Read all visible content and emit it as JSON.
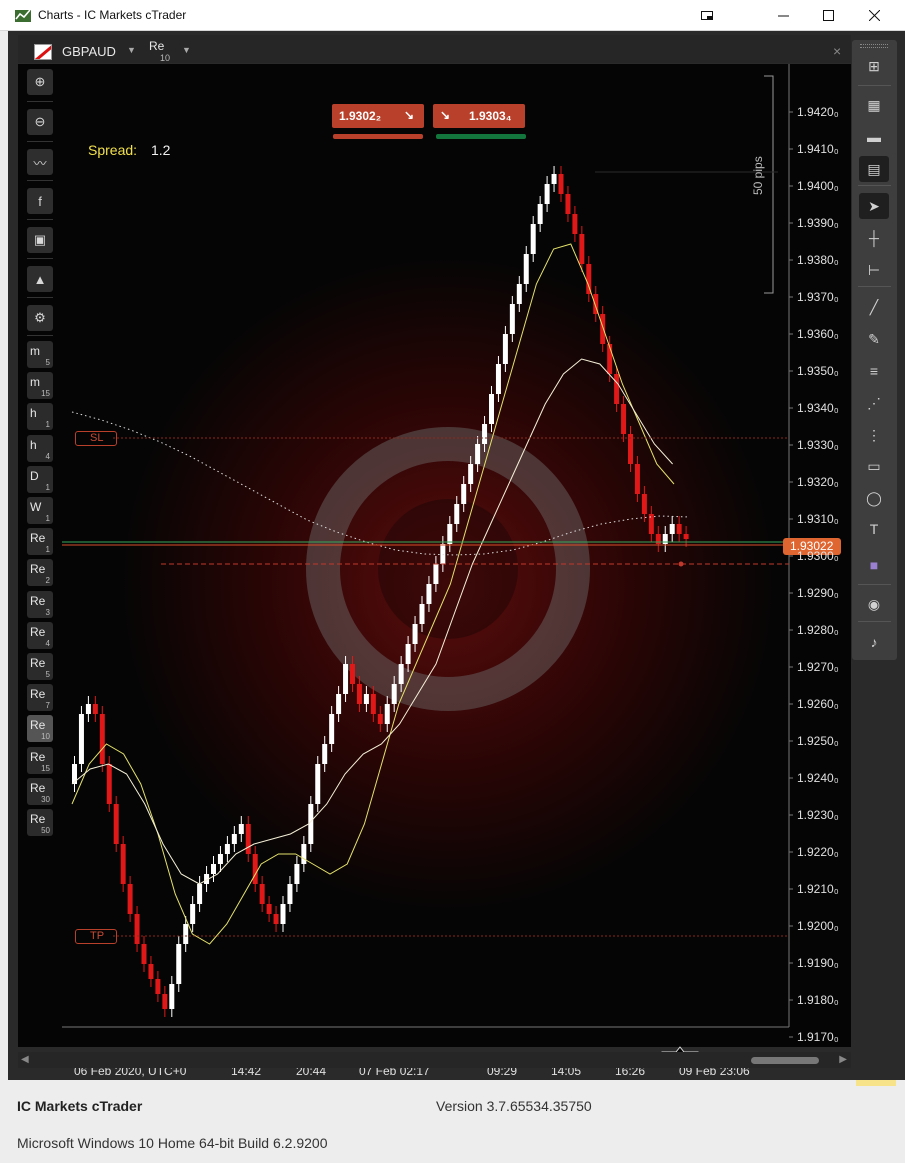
{
  "window": {
    "title": "Charts - IC Markets cTrader",
    "cast_icon": "cast-icon",
    "min_icon": "minimize-icon",
    "max_icon": "maximize-icon",
    "close_icon": "close-icon"
  },
  "chart_header": {
    "symbol": "GBPAUD",
    "timeframe": "Re",
    "timeframe_sub": "10",
    "close_symbol": "×"
  },
  "left_toolbar": {
    "tools": [
      {
        "name": "zoom-in-icon",
        "glyph": "⊕"
      },
      {
        "name": "zoom-out-icon",
        "glyph": "⊖"
      },
      {
        "name": "indicators-icon",
        "glyph": "〰"
      },
      {
        "name": "facebook-icon",
        "glyph": "f"
      },
      {
        "name": "robot-icon",
        "glyph": "▣"
      },
      {
        "name": "patterns-icon",
        "glyph": "▲"
      },
      {
        "name": "settings-icon",
        "glyph": "⚙"
      }
    ],
    "timeframes": [
      {
        "main": "m",
        "sub": "5"
      },
      {
        "main": "m",
        "sub": "15"
      },
      {
        "main": "h",
        "sub": "1"
      },
      {
        "main": "h",
        "sub": "4"
      },
      {
        "main": "D",
        "sub": "1"
      },
      {
        "main": "W",
        "sub": "1"
      },
      {
        "main": "Re",
        "sub": "1"
      },
      {
        "main": "Re",
        "sub": "2"
      },
      {
        "main": "Re",
        "sub": "3"
      },
      {
        "main": "Re",
        "sub": "4"
      },
      {
        "main": "Re",
        "sub": "5"
      },
      {
        "main": "Re",
        "sub": "7"
      },
      {
        "main": "Re",
        "sub": "10"
      },
      {
        "main": "Re",
        "sub": "15"
      },
      {
        "main": "Re",
        "sub": "30"
      },
      {
        "main": "Re",
        "sub": "50"
      }
    ],
    "active_timeframe_index": 12
  },
  "spread": {
    "label": "Spread:",
    "value": "1.2"
  },
  "quick_trade": {
    "sell_price": "1.9302₂",
    "buy_price": "1.9303₄",
    "sell_color": "#b9402a",
    "buy_color": "#13763c"
  },
  "levels": {
    "sl_label": "SL",
    "tp_label": "TP"
  },
  "current_price": "1.93022",
  "pips_label": "50 pips",
  "price_axis": [
    "1.9420₀",
    "1.9410₀",
    "1.9400₀",
    "1.9390₀",
    "1.9380₀",
    "1.9370₀",
    "1.9360₀",
    "1.9350₀",
    "1.9340₀",
    "1.9330₀",
    "1.9320₀",
    "1.9310₀",
    "1.9300₀",
    "1.9290₀",
    "1.9280₀",
    "1.9270₀",
    "1.9260₀",
    "1.9250₀",
    "1.9240₀",
    "1.9230₀",
    "1.9220₀",
    "1.9210₀",
    "1.9200₀",
    "1.9190₀",
    "1.9180₀",
    "1.9170₀"
  ],
  "time_axis": [
    "06 Feb 2020, UTC+0",
    "14:42",
    "20:44",
    "07 Feb 02:17",
    "09:29",
    "14:05",
    "16:26",
    "09 Feb 23:06"
  ],
  "right_toolbar": {
    "tools": [
      "new-chart-icon",
      "grid-layout-icon",
      "single-layout-icon",
      "split-layout-icon",
      "cursor-icon",
      "crosshair-icon",
      "ruler-icon",
      "trendline-icon",
      "pen-icon",
      "fibonacci-icon",
      "pitchfork-icon",
      "fib-extension-icon",
      "rectangle-icon",
      "ellipse-icon",
      "text-icon",
      "color-icon",
      "camera-icon",
      "alert-bell-icon"
    ]
  },
  "footer": {
    "product": "IC Markets cTrader",
    "version": "Version 3.7.65534.35750",
    "os": "Microsoft Windows 10 Home 64-bit Build 6.2.9200"
  }
}
